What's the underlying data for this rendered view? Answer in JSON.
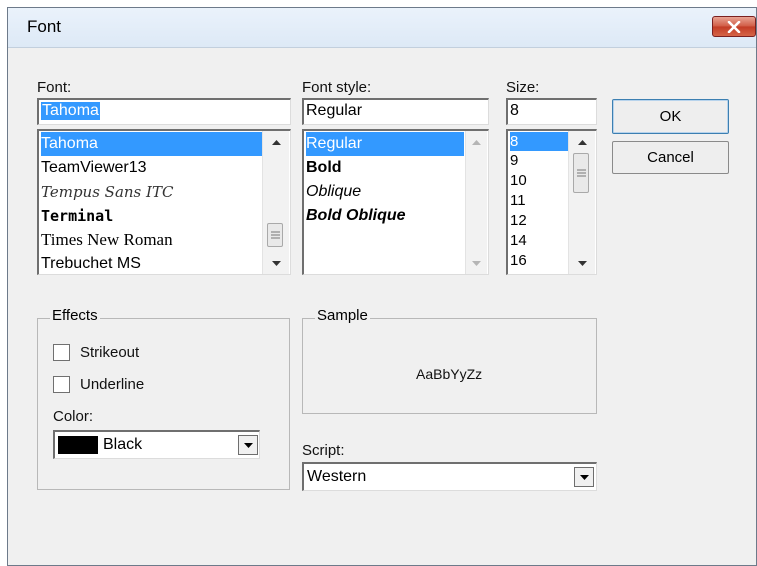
{
  "window": {
    "title": "Font"
  },
  "font": {
    "label": "Font:",
    "value": "Tahoma",
    "items": [
      "Tahoma",
      "TeamViewer13",
      "Tempus Sans ITC",
      "Terminal",
      "Times New Roman",
      "Trebuchet MS"
    ],
    "selected": "Tahoma"
  },
  "style": {
    "label": "Font style:",
    "value": "Regular",
    "items": [
      "Regular",
      "Bold",
      "Oblique",
      "Bold Oblique"
    ],
    "selected": "Regular"
  },
  "size": {
    "label": "Size:",
    "value": "8",
    "items": [
      "8",
      "9",
      "10",
      "11",
      "12",
      "14",
      "16"
    ],
    "selected": "8"
  },
  "buttons": {
    "ok": "OK",
    "cancel": "Cancel"
  },
  "effects": {
    "title": "Effects",
    "strikeout": {
      "label": "Strikeout",
      "checked": false
    },
    "underline": {
      "label": "Underline",
      "checked": false
    },
    "color_label": "Color:",
    "color_value": "Black",
    "color_swatch": "#000000"
  },
  "sample": {
    "title": "Sample",
    "text": "AaBbYyZz"
  },
  "script": {
    "label": "Script:",
    "value": "Western"
  },
  "colors": {
    "selection": "#3399ff",
    "close_button": "#c94b34"
  }
}
